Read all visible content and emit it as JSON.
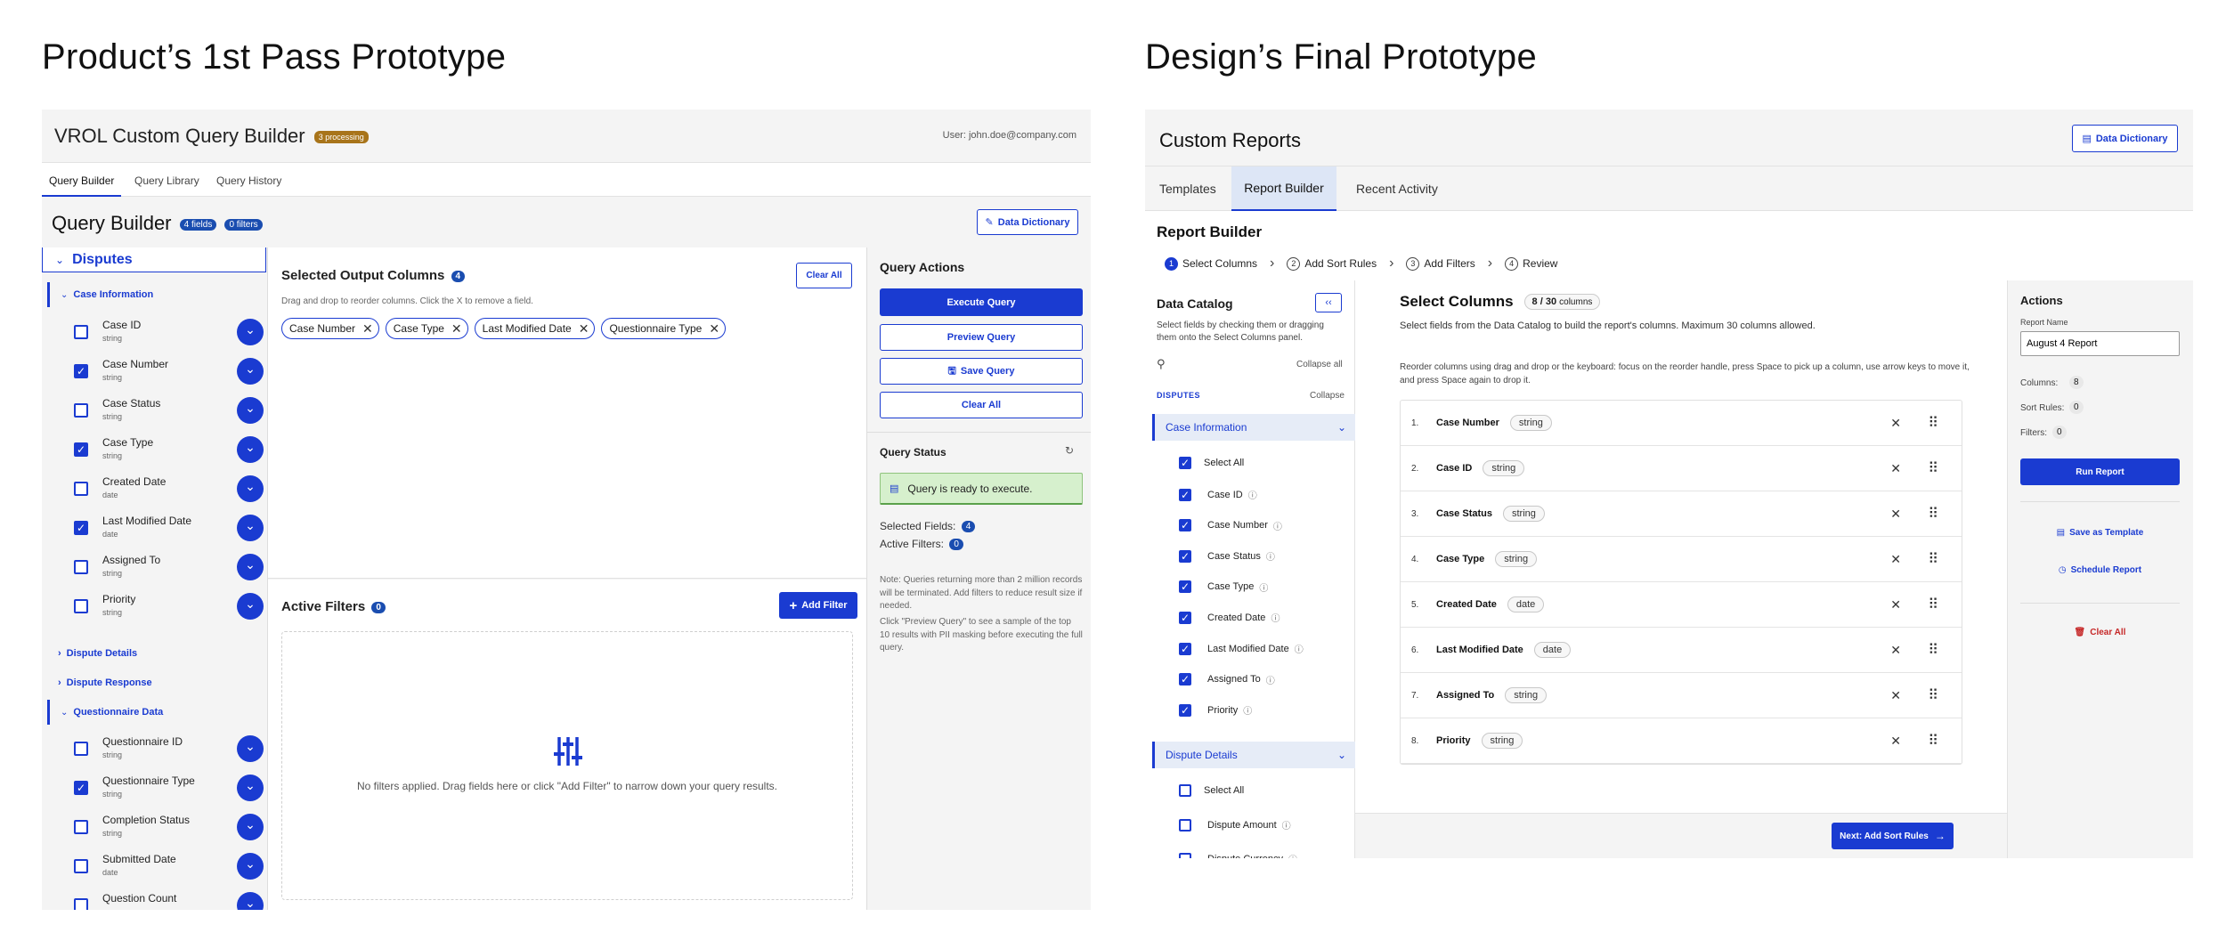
{
  "headings": {
    "left": "Product’s 1st Pass Prototype",
    "right": "Design’s Final Prototype"
  },
  "p1": {
    "app_title": "VROL Custom Query Builder",
    "processing": "3 processing",
    "user": "User: john.doe@company.com",
    "tabs": [
      "Query Builder",
      "Query Library",
      "Query History"
    ],
    "page_title": "Query Builder",
    "fields_badge": "4 fields",
    "filters_badge": "0 filters",
    "data_dictionary": "Data Dictionary",
    "disputes": "Disputes",
    "case_info": "Case Information",
    "fields": [
      {
        "name": "Case ID",
        "type": "string",
        "checked": false
      },
      {
        "name": "Case Number",
        "type": "string",
        "checked": true
      },
      {
        "name": "Case Status",
        "type": "string",
        "checked": false
      },
      {
        "name": "Case Type",
        "type": "string",
        "checked": true
      },
      {
        "name": "Created Date",
        "type": "date",
        "checked": false
      },
      {
        "name": "Last Modified Date",
        "type": "date",
        "checked": true
      },
      {
        "name": "Assigned To",
        "type": "string",
        "checked": false
      },
      {
        "name": "Priority",
        "type": "string",
        "checked": false
      }
    ],
    "dispute_details": "Dispute Details",
    "dispute_response": "Dispute Response",
    "questionnaire_data": "Questionnaire Data",
    "q_fields": [
      {
        "name": "Questionnaire ID",
        "type": "string",
        "checked": false
      },
      {
        "name": "Questionnaire Type",
        "type": "string",
        "checked": true
      },
      {
        "name": "Completion Status",
        "type": "string",
        "checked": false
      },
      {
        "name": "Submitted Date",
        "type": "date",
        "checked": false
      },
      {
        "name": "Question Count",
        "type": "",
        "checked": false
      }
    ],
    "selected_title": "Selected Output Columns",
    "selected_count": "4",
    "clear_all": "Clear All",
    "drag_hint": "Drag and drop to reorder columns. Click the X to remove a field.",
    "chips": [
      "Case Number",
      "Case Type",
      "Last Modified Date",
      "Questionnaire Type"
    ],
    "active_filters": "Active Filters",
    "filters_count": "0",
    "add_filter": "Add Filter",
    "no_filters": "No filters applied. Drag fields here or click \"Add Filter\" to narrow down your query results.",
    "actions_title": "Query Actions",
    "execute": "Execute Query",
    "preview": "Preview Query",
    "save": "Save Query",
    "clear": "Clear All",
    "status_title": "Query Status",
    "status_msg": "Query is ready to execute.",
    "selected_fields_label": "Selected Fields:",
    "selected_fields_val": "4",
    "active_filters_label": "Active Filters:",
    "active_filters_val": "0",
    "note1": "Note: Queries returning more than 2 million records will be terminated. Add filters to reduce result size if needed.",
    "note2": "Click \"Preview Query\" to see a sample of the top 10 results with PII masking before executing the full query."
  },
  "p2": {
    "app_title": "Custom Reports",
    "data_dictionary": "Data Dictionary",
    "tabs": [
      "Templates",
      "Report Builder",
      "Recent Activity"
    ],
    "page_title": "Report Builder",
    "steps": [
      {
        "n": "1",
        "label": "Select Columns"
      },
      {
        "n": "2",
        "label": "Add Sort Rules"
      },
      {
        "n": "3",
        "label": "Add Filters"
      },
      {
        "n": "4",
        "label": "Review"
      }
    ],
    "catalog_title": "Data Catalog",
    "catalog_desc": "Select fields by checking them or dragging them onto the Select Columns panel.",
    "collapse_all": "Collapse all",
    "disputes": "DISPUTES",
    "collapse": "Collapse",
    "case_info": "Case Information",
    "select_all": "Select All",
    "case_fields": [
      "Case ID",
      "Case Number",
      "Case Status",
      "Case Type",
      "Created Date",
      "Last Modified Date",
      "Assigned To",
      "Priority"
    ],
    "dispute_details": "Dispute Details",
    "dispute_fields": [
      "Select All",
      "Dispute Amount",
      "Dispute Currency"
    ],
    "select_title": "Select Columns",
    "count": "8 / 30",
    "count_unit": "columns",
    "select_desc": "Select fields from the Data Catalog to build the report's columns. Maximum 30 columns allowed.",
    "reorder_desc": "Reorder columns using drag and drop or the keyboard: focus on the reorder handle, press Space to pick up a column, use arrow keys to move it, and press Space again to drop it.",
    "columns": [
      {
        "n": "1.",
        "name": "Case Number",
        "type": "string"
      },
      {
        "n": "2.",
        "name": "Case ID",
        "type": "string"
      },
      {
        "n": "3.",
        "name": "Case Status",
        "type": "string"
      },
      {
        "n": "4.",
        "name": "Case Type",
        "type": "string"
      },
      {
        "n": "5.",
        "name": "Created Date",
        "type": "date"
      },
      {
        "n": "6.",
        "name": "Last Modified Date",
        "type": "date"
      },
      {
        "n": "7.",
        "name": "Assigned To",
        "type": "string"
      },
      {
        "n": "8.",
        "name": "Priority",
        "type": "string"
      }
    ],
    "next": "Next: Add Sort Rules",
    "actions_title": "Actions",
    "report_name_label": "Report Name",
    "report_name": "August 4 Report",
    "columns_label": "Columns:",
    "columns_val": "8",
    "sort_label": "Sort Rules:",
    "sort_val": "0",
    "filters_label": "Filters:",
    "filters_val": "0",
    "run": "Run Report",
    "save_template": "Save as Template",
    "schedule": "Schedule Report",
    "clear_all": "Clear All"
  }
}
